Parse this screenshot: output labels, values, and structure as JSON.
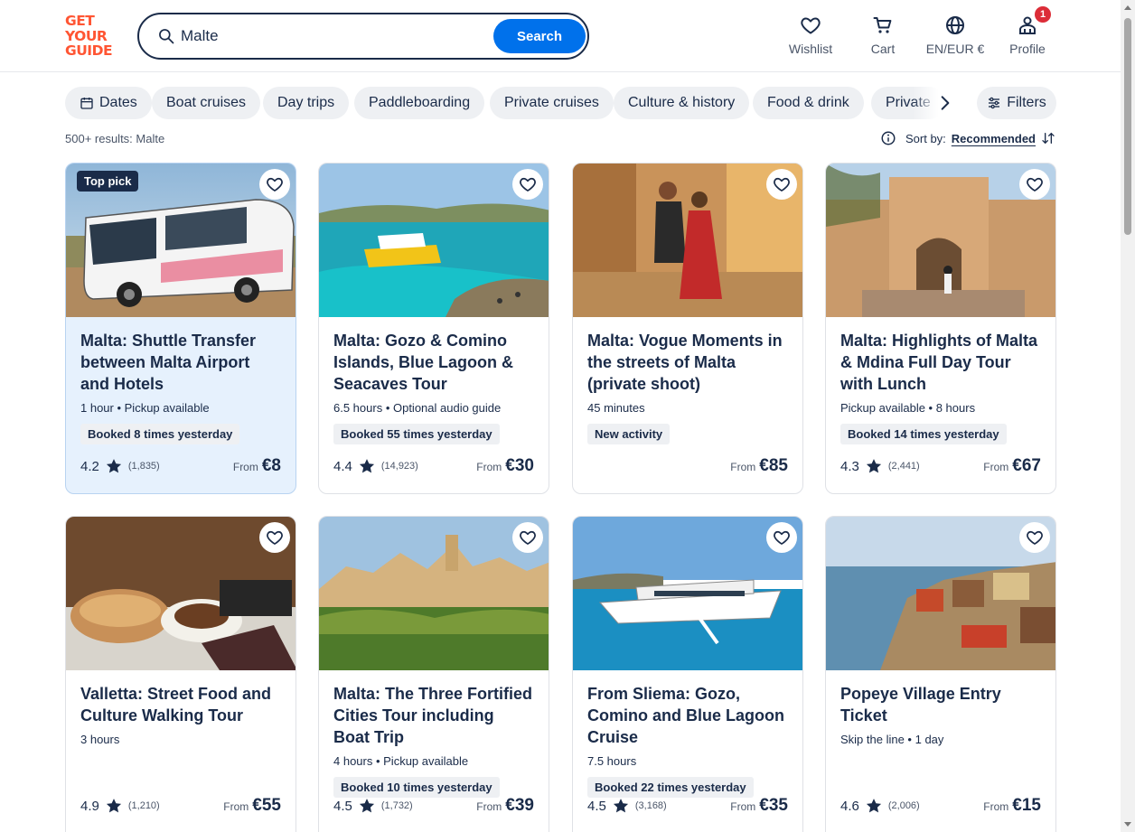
{
  "header": {
    "logo_lines": [
      "GET",
      "YOUR",
      "GUIDE"
    ],
    "search_value": "Malte",
    "search_button": "Search",
    "nav": [
      {
        "label": "Wishlist",
        "icon": "heart-icon"
      },
      {
        "label": "Cart",
        "icon": "cart-icon"
      },
      {
        "label": "EN/EUR €",
        "icon": "globe-icon"
      },
      {
        "label": "Profile",
        "icon": "profile-icon",
        "badge": "1"
      }
    ]
  },
  "chips": [
    "Dates",
    "Boat cruises",
    "Day trips",
    "Paddleboarding",
    "Private cruises",
    "Culture & history",
    "Food & drink",
    "Private"
  ],
  "filters_label": "Filters",
  "results": {
    "count_text": "500+ results: Malte",
    "sort_label": "Sort by:",
    "sort_value": "Recommended"
  },
  "colors": {
    "brand": "#ff5533",
    "accent": "#0071eb",
    "text": "#1a2b49",
    "badge": "#dc2d38"
  },
  "cards": [
    {
      "title": "Malta: Shuttle Transfer between Malta Airport and Hotels",
      "meta": "1 hour • Pickup available",
      "tag": "Booked 8 times yesterday",
      "rating": "4.2",
      "reviews": "(1,835)",
      "from": "From",
      "price": "€8",
      "top_pick": "Top pick"
    },
    {
      "title": "Malta: Gozo & Comino Islands, Blue Lagoon & Seacaves Tour",
      "meta": "6.5 hours • Optional audio guide",
      "tag": "Booked 55 times yesterday",
      "rating": "4.4",
      "reviews": "(14,923)",
      "from": "From",
      "price": "€30"
    },
    {
      "title": "Malta: Vogue Moments in the streets of Malta (private shoot)",
      "meta": "45 minutes",
      "tag": "New activity",
      "rating": "",
      "reviews": "",
      "from": "From",
      "price": "€85"
    },
    {
      "title": "Malta: Highlights of Malta & Mdina Full Day Tour with Lunch",
      "meta": "Pickup available • 8 hours",
      "tag": "Booked 14 times yesterday",
      "rating": "4.3",
      "reviews": "(2,441)",
      "from": "From",
      "price": "€67"
    },
    {
      "title": "Valletta: Street Food and Culture Walking Tour",
      "meta": "3 hours",
      "tag": "",
      "rating": "4.9",
      "reviews": "(1,210)",
      "from": "From",
      "price": "€55"
    },
    {
      "title": "Malta: The Three Fortified Cities Tour including Boat Trip",
      "meta": "4 hours • Pickup available",
      "tag": "Booked 10 times yesterday",
      "rating": "4.5",
      "reviews": "(1,732)",
      "from": "From",
      "price": "€39"
    },
    {
      "title": "From Sliema: Gozo, Comino and Blue Lagoon Cruise",
      "meta": "7.5 hours",
      "tag": "Booked 22 times yesterday",
      "rating": "4.5",
      "reviews": "(3,168)",
      "from": "From",
      "price": "€35"
    },
    {
      "title": "Popeye Village Entry Ticket",
      "meta": "Skip the line • 1 day",
      "tag": "",
      "rating": "4.6",
      "reviews": "(2,006)",
      "from": "From",
      "price": "€15"
    }
  ]
}
